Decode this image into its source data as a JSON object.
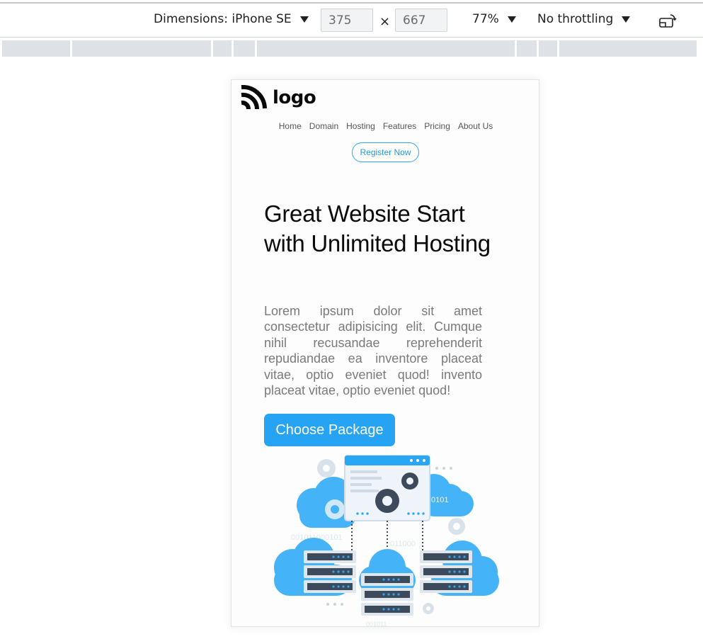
{
  "toolbar": {
    "dimensions_label": "Dimensions: iPhone SE",
    "width_value": "375",
    "height_value": "667",
    "times_symbol": "×",
    "zoom_label": "77%",
    "throttling_label": "No throttling",
    "icons": [
      "caret-down-icon",
      "rotate-icon"
    ]
  },
  "page": {
    "logo_text": "logo",
    "nav": [
      "Home",
      "Domain",
      "Hosting",
      "Features",
      "Pricing",
      "About Us"
    ],
    "register_label": "Register Now",
    "hero_title": "Great Website Start with Unlimited Hosting",
    "hero_text": "Lorem ipsum dolor sit amet consectetur adipisicing elit. Cumque nihil recusandae reprehenderit repudiandae ea inventore placeat vitae, optio eveniet quod! invento placeat vitae, optio eveniet quod!",
    "cta_label": "Choose Package",
    "illustration_binary": [
      "0101",
      "001011000101",
      "011000",
      "001011"
    ]
  },
  "colors": {
    "accent": "#26a4f3",
    "cloud": "#3fb0f5",
    "server": "#3d4a5c"
  }
}
